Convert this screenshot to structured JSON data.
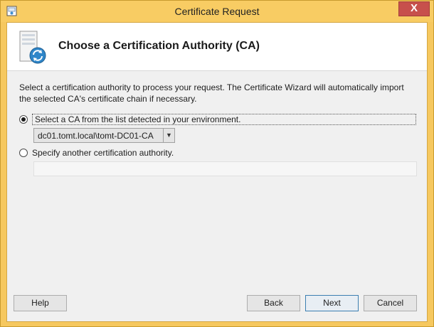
{
  "window": {
    "title": "Certificate Request",
    "close_glyph": "X",
    "accent": "#f8cc63"
  },
  "header": {
    "title": "Choose a Certification Authority (CA)",
    "icon": "server-sync-icon"
  },
  "description": "Select a certification authority to process your request. The Certificate Wizard will automatically import the selected CA's certificate chain if necessary.",
  "options": {
    "detected": {
      "label": "Select a CA from the list detected in your environment.",
      "checked": true,
      "selected_ca": "dc01.tomt.local\\tomt-DC01-CA"
    },
    "specify": {
      "label": "Specify another certification authority.",
      "checked": false,
      "value": ""
    }
  },
  "buttons": {
    "help": "Help",
    "back": "Back",
    "next": "Next",
    "cancel": "Cancel"
  }
}
